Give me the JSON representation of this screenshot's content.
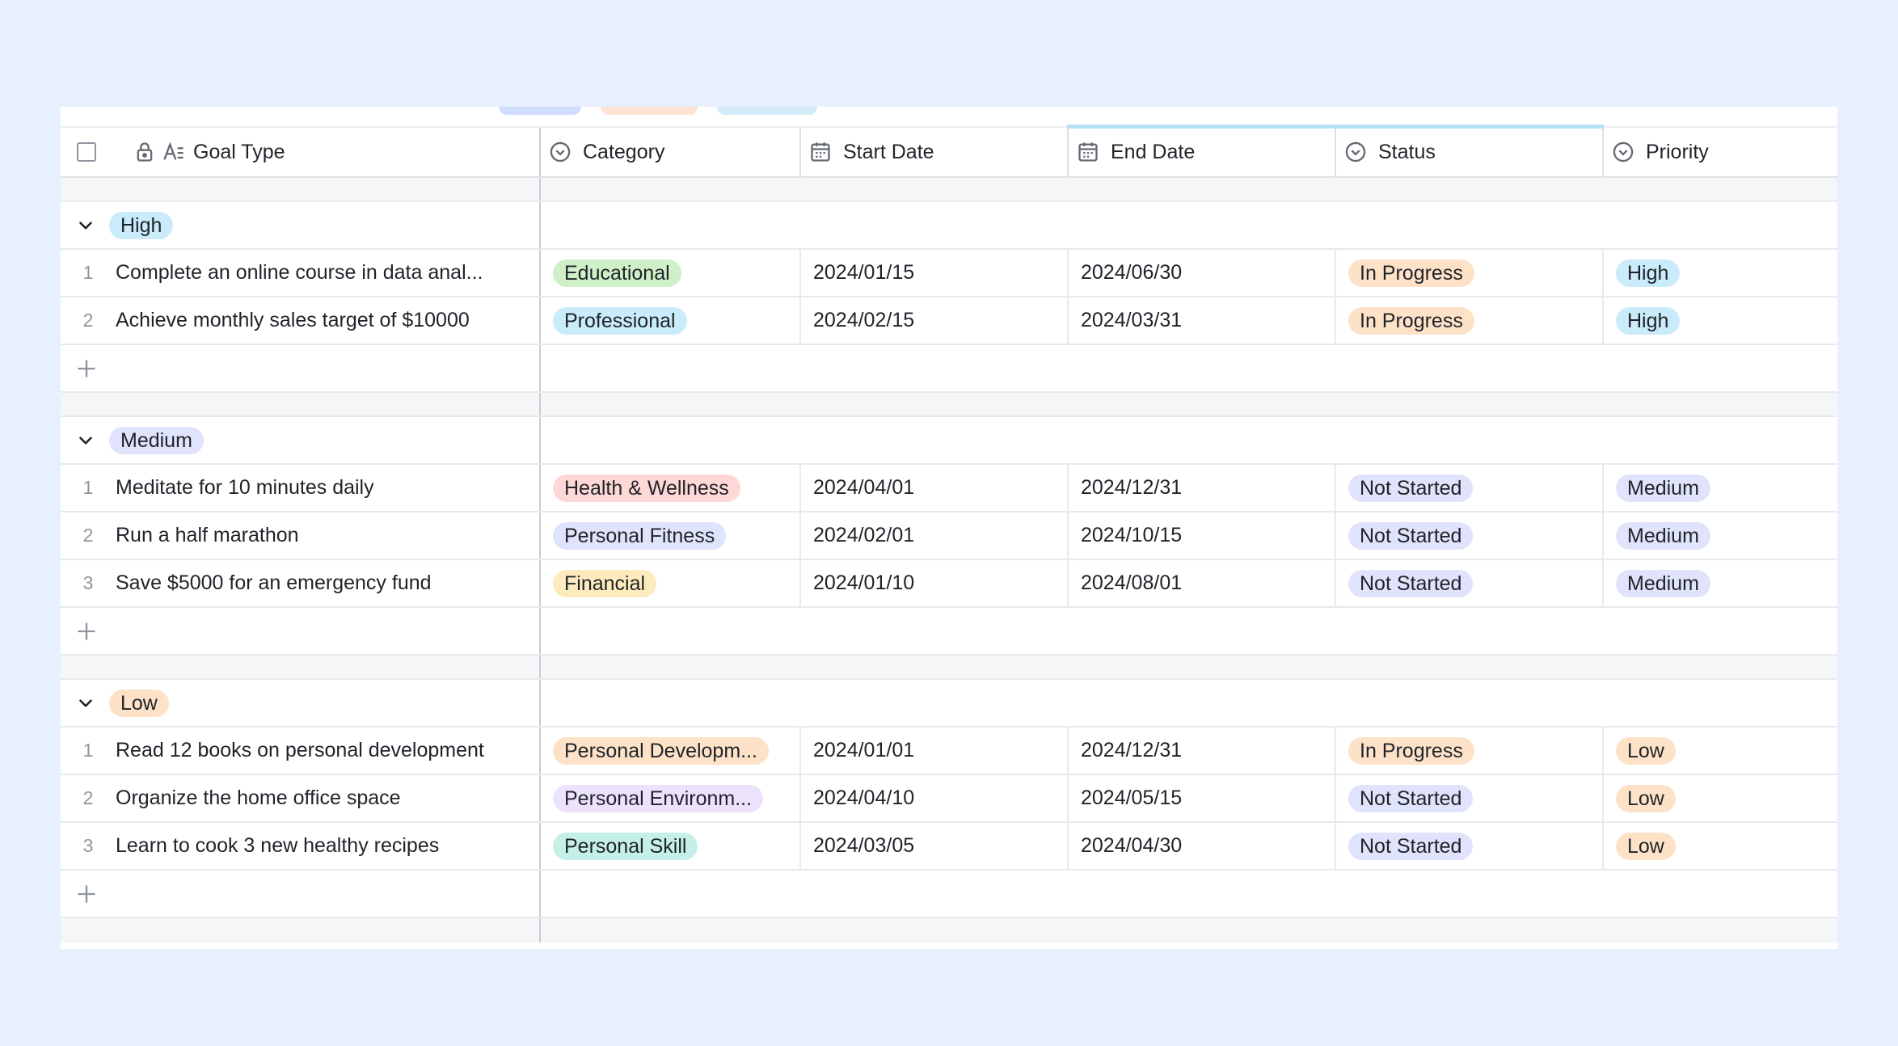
{
  "columns": {
    "goal_type": "Goal Type",
    "category": "Category",
    "start_date": "Start Date",
    "end_date": "End Date",
    "status": "Status",
    "priority": "Priority"
  },
  "colors": {
    "background": "#e8effe",
    "tag_high": "#c9ebfa",
    "tag_medium": "#dfe3fb",
    "tag_low": "#fde2c8",
    "tag_in_progress": "#fde2c8",
    "tag_not_started": "#dfe3fb",
    "cat_educational": "#cfefc6",
    "cat_professional": "#c9ebfa",
    "cat_health": "#fdd8d6",
    "cat_fitness": "#dfe3fb",
    "cat_financial": "#fdebbd",
    "cat_personal_development": "#fde2c8",
    "cat_personal_environment": "#ece2fc",
    "cat_personal_skill": "#c5f0e8"
  },
  "groups": [
    {
      "label": "High",
      "rows": [
        {
          "num": "1",
          "goal": "Complete an online course in data anal...",
          "category": "Educational",
          "start": "2024/01/15",
          "end": "2024/06/30",
          "status": "In Progress",
          "priority": "High"
        },
        {
          "num": "2",
          "goal": "Achieve monthly sales target of $10000",
          "category": "Professional",
          "start": "2024/02/15",
          "end": "2024/03/31",
          "status": "In Progress",
          "priority": "High"
        }
      ]
    },
    {
      "label": "Medium",
      "rows": [
        {
          "num": "1",
          "goal": "Meditate for 10 minutes daily",
          "category": "Health & Wellness",
          "start": "2024/04/01",
          "end": "2024/12/31",
          "status": "Not Started",
          "priority": "Medium"
        },
        {
          "num": "2",
          "goal": "Run a half marathon",
          "category": "Personal Fitness",
          "start": "2024/02/01",
          "end": "2024/10/15",
          "status": "Not Started",
          "priority": "Medium"
        },
        {
          "num": "3",
          "goal": "Save $5000 for an emergency fund",
          "category": "Financial",
          "start": "2024/01/10",
          "end": "2024/08/01",
          "status": "Not Started",
          "priority": "Medium"
        }
      ]
    },
    {
      "label": "Low",
      "rows": [
        {
          "num": "1",
          "goal": "Read 12 books on personal development",
          "category": "Personal Developm...",
          "start": "2024/01/01",
          "end": "2024/12/31",
          "status": "In Progress",
          "priority": "Low"
        },
        {
          "num": "2",
          "goal": "Organize the home office space",
          "category": "Personal Environm...",
          "start": "2024/04/10",
          "end": "2024/05/15",
          "status": "Not Started",
          "priority": "Low"
        },
        {
          "num": "3",
          "goal": "Learn to cook 3 new healthy recipes",
          "category": "Personal Skill",
          "start": "2024/03/05",
          "end": "2024/04/30",
          "status": "Not Started",
          "priority": "Low"
        }
      ]
    }
  ]
}
